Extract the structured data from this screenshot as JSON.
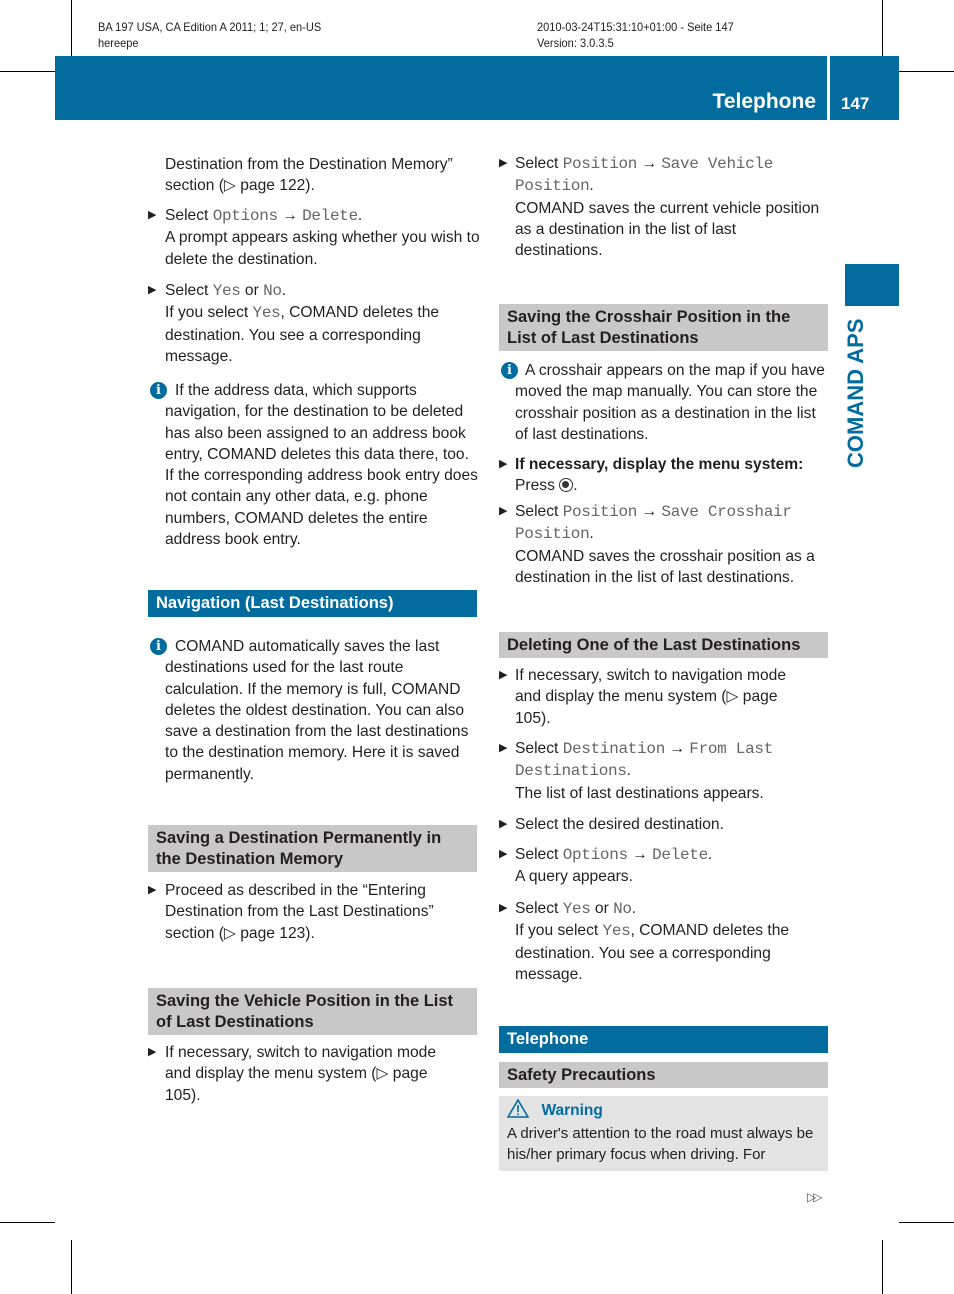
{
  "header": {
    "left1": "BA 197 USA, CA Edition A 2011; 1; 27, en-US",
    "left2": "hereepe",
    "right1": "2010-03-24T15:31:10+01:00 - Seite 147",
    "right2": "Version: 3.0.3.5"
  },
  "banner": {
    "title": "Telephone",
    "page": "147"
  },
  "side_tab": "COMAND APS",
  "colors": {
    "brand": "#036c9f",
    "heading_gray": "#c8c8c8",
    "warning_bg": "#e3e3e3"
  },
  "left": {
    "p1": "Destination from the Destination Memory” section (▷ page 122).",
    "b1": {
      "pre": "Select ",
      "c1": "Options",
      "arrow": " → ",
      "c2": "Delete",
      "post": ".",
      "desc": "A prompt appears asking whether you wish to delete the destination."
    },
    "b2": {
      "pre": "Select ",
      "c1": "Yes",
      "mid": " or ",
      "c2": "No",
      "post": ".",
      "desc_pre": "If you select ",
      "desc_c": "Yes",
      "desc_post": ", COMAND deletes the destination. You see a corresponding message."
    },
    "info1": "If the address data, which supports navigation, for the destination to be deleted has also been assigned to an address book entry, COMAND deletes this data there, too. If the corresponding address book entry does not contain any other data, e.g. phone numbers, COMAND deletes the entire address book entry.",
    "h_nav": "Navigation (Last Destinations)",
    "info2": "COMAND automatically saves the last destinations used for the last route calculation. If the memory is full, COMAND deletes the oldest destination. You can also save a destination from the last destinations to the destination memory. Here it is saved permanently.",
    "h_perm": "Saving a Destination Permanently in the Destination Memory",
    "b3": "Proceed as described in the “Entering Destination from the Last Destinations” section (▷ page 123).",
    "h_vehicle": "Saving the Vehicle Position in the List of Last Destinations",
    "b4": "If necessary, switch to navigation mode and display the menu system (▷ page 105)."
  },
  "right": {
    "b1": {
      "pre": "Select ",
      "c1": "Position",
      "arrow": " → ",
      "c2": "Save Vehicle Position",
      "post": ".",
      "desc": "COMAND saves the current vehicle position as a destination in the list of last destinations."
    },
    "h_cross": "Saving the Crosshair Position in the List of Last Destinations",
    "info": "A crosshair appears on the map if you have moved the map manually. You can store the crosshair position as a destination in the list of last destinations.",
    "b2": {
      "bold": "If necessary, display the menu system:",
      "desc_pre": "Press ",
      "icon": "controller-press-icon",
      "desc_post": "."
    },
    "b3": {
      "pre": "Select ",
      "c1": "Position",
      "arrow": " → ",
      "c2": "Save Crosshair Position",
      "post": ".",
      "desc": "COMAND saves the crosshair position as a destination in the list of last destinations."
    },
    "h_delete": "Deleting One of the Last Destinations",
    "b4": "If necessary, switch to navigation mode and display the menu system (▷ page 105).",
    "b5": {
      "pre": "Select ",
      "c1": "Destination",
      "arrow": " → ",
      "c2": "From Last Destinations",
      "post": ".",
      "desc": "The list of last destinations appears."
    },
    "b6": "Select the desired destination.",
    "b7": {
      "pre": "Select ",
      "c1": "Options",
      "arrow": " → ",
      "c2": "Delete",
      "post": ".",
      "desc": "A query appears."
    },
    "b8": {
      "pre": "Select ",
      "c1": "Yes",
      "mid": " or ",
      "c2": "No",
      "post": ".",
      "desc_pre": "If you select ",
      "desc_c": "Yes",
      "desc_post": ", COMAND deletes the destination. You see a corresponding message."
    },
    "h_tel": "Telephone",
    "h_safety": "Safety Precautions",
    "warning": {
      "title": "Warning",
      "text": "A driver's attention to the road must always be his/her primary focus when driving. For"
    },
    "continue": "▷▷"
  }
}
